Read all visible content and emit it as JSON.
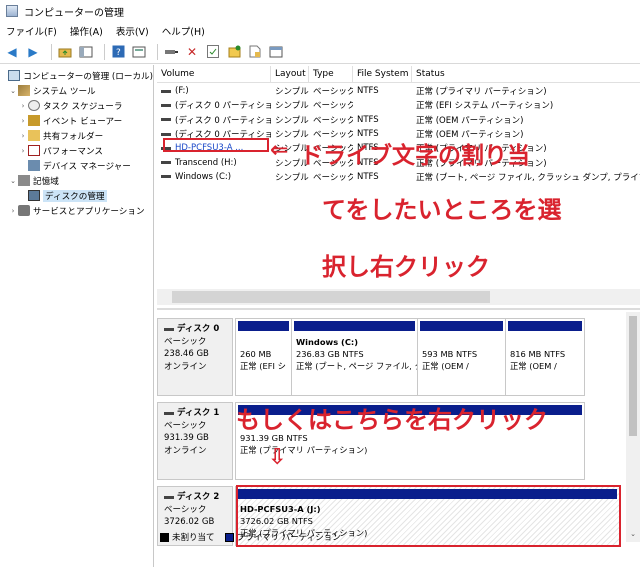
{
  "window": {
    "title": "コンピューターの管理"
  },
  "menu": [
    "ファイル(F)",
    "操作(A)",
    "表示(V)",
    "ヘルプ(H)"
  ],
  "toolbar": {
    "icons": [
      "back-arrow-icon",
      "forward-arrow-icon",
      "up-folder-icon",
      "show-hide-tree-icon",
      "help-icon",
      "properties-icon",
      "connect-icon",
      "delete-x-icon",
      "check-icon",
      "folder-add-icon",
      "page-icon",
      "window-icon"
    ]
  },
  "tree": [
    {
      "label": "コンピューターの管理 (ローカル)",
      "indent": 0,
      "arrow": "",
      "icon": "pc"
    },
    {
      "label": "システム ツール",
      "indent": 1,
      "arrow": "⌄",
      "icon": "tools"
    },
    {
      "label": "タスク スケジューラ",
      "indent": 2,
      "arrow": "›",
      "icon": "clock"
    },
    {
      "label": "イベント ビューアー",
      "indent": 2,
      "arrow": "›",
      "icon": "book"
    },
    {
      "label": "共有フォルダー",
      "indent": 2,
      "arrow": "›",
      "icon": "folder"
    },
    {
      "label": "パフォーマンス",
      "indent": 2,
      "arrow": "›",
      "icon": "perf"
    },
    {
      "label": "デバイス マネージャー",
      "indent": 2,
      "arrow": "",
      "icon": "devmgr"
    },
    {
      "label": "記憶域",
      "indent": 1,
      "arrow": "⌄",
      "icon": "storage"
    },
    {
      "label": "ディスクの管理",
      "indent": 2,
      "arrow": "",
      "icon": "disk",
      "selected": true
    },
    {
      "label": "サービスとアプリケーション",
      "indent": 1,
      "arrow": "›",
      "icon": "svc"
    }
  ],
  "volume_table": {
    "headers": [
      "Volume",
      "Layout",
      "Type",
      "File System",
      "Status"
    ],
    "rows": [
      [
        "(F:)",
        "シンプル",
        "ベーシック",
        "NTFS",
        "正常 (プライマリ パーティション)"
      ],
      [
        "(ディスク 0 パーティション 1)",
        "シンプル",
        "ベーシック",
        "",
        "正常 (EFI システム パーティション)"
      ],
      [
        "(ディスク 0 パーティション 4)",
        "シンプル",
        "ベーシック",
        "NTFS",
        "正常 (OEM パーティション)"
      ],
      [
        "(ディスク 0 パーティション 5)",
        "シンプル",
        "ベーシック",
        "NTFS",
        "正常 (OEM パーティション)"
      ],
      [
        "HD-PCFSU3-A ...",
        "シンプル",
        "ベーシック",
        "NTFS",
        "正常 (プライマリ パーティション)"
      ],
      [
        "Transcend (H:)",
        "シンプル",
        "ベーシック",
        "NTFS",
        "正常 (プライマリ パーティション)"
      ],
      [
        "Windows (C:)",
        "シンプル",
        "ベーシック",
        "NTFS",
        "正常 (ブート, ページ ファイル, クラッシュ ダンプ, プライマリ パーティ"
      ]
    ]
  },
  "disks": [
    {
      "name": "ディスク 0",
      "type": "ベーシック",
      "size": "238.46 GB",
      "status": "オンライン",
      "partitions": [
        {
          "name": "",
          "size": "260 MB",
          "status": "正常 (EFI シ"
        },
        {
          "name": "Windows  (C:)",
          "size": "236.83 GB NTFS",
          "status": "正常 (ブート, ページ ファイル, ク"
        },
        {
          "name": "",
          "size": "593 MB NTFS",
          "status": "正常 (OEM /"
        },
        {
          "name": "",
          "size": "816 MB NTFS",
          "status": "正常 (OEM /"
        }
      ]
    },
    {
      "name": "ディスク 1",
      "type": "ベーシック",
      "size": "931.39 GB",
      "status": "オンライン",
      "partitions": [
        {
          "name": "",
          "size": "931.39 GB NTFS",
          "status": "正常 (プライマリ パーティション)"
        }
      ]
    },
    {
      "name": "ディスク 2",
      "type": "ベーシック",
      "size": "3726.02 GB",
      "status": "",
      "partitions": [
        {
          "name": "HD-PCFSU3-A  (J:)",
          "size": "3726.02 GB NTFS",
          "status": "正常 (プライマリ パーティション)"
        }
      ]
    }
  ],
  "legend": {
    "unallocated": "未割り当て",
    "primary": "プライマリ パーティション"
  },
  "annotations": {
    "line1": "ドライブ文字の割り当",
    "line2": "てをしたいところを選",
    "line3": "択し右クリック",
    "line4": "もしくはこちらを右クリック",
    "left_arrow": "⇐",
    "down_arrow": "⇩"
  },
  "colors": {
    "annotation_red": "#d9232e",
    "partition_bar": "#0a1e8c",
    "selection": "#cce4f7"
  }
}
